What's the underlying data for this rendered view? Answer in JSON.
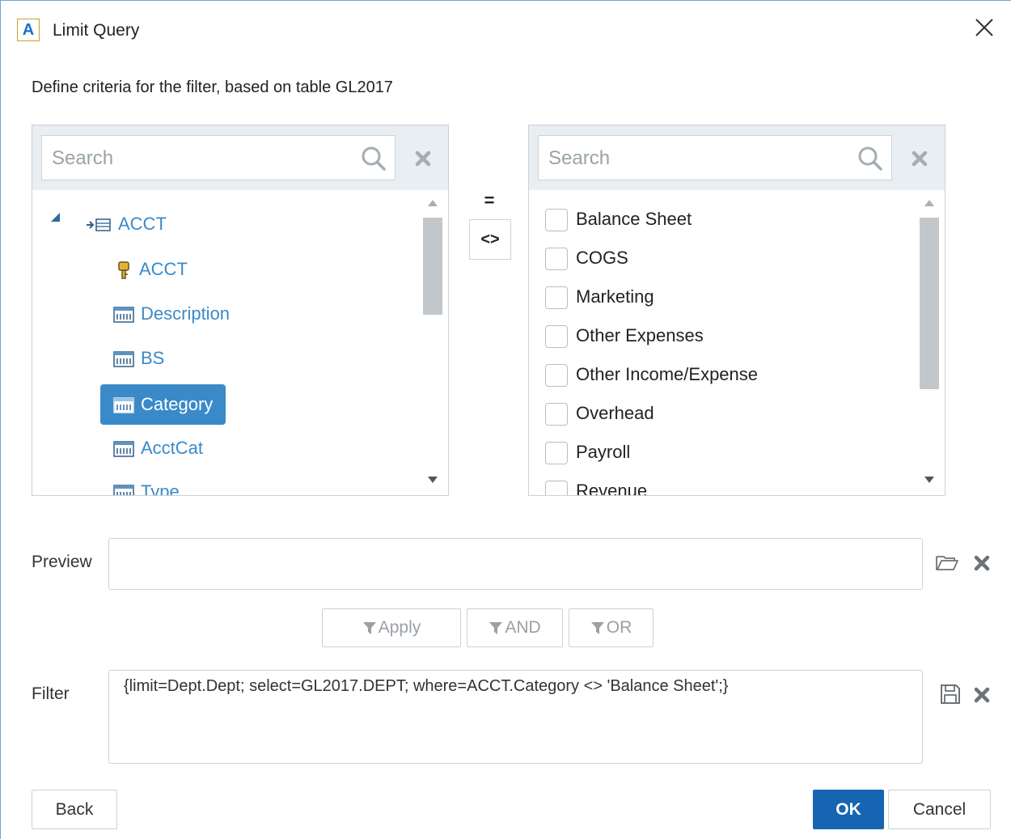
{
  "window": {
    "title": "Limit Query",
    "app_icon_letter": "A"
  },
  "subtitle": "Define criteria for the filter, based on table GL2017",
  "left_panel": {
    "search_placeholder": "Search",
    "tree": [
      {
        "label": "ACCT",
        "icon": "table-link-icon",
        "level": 0,
        "expanded": true
      },
      {
        "label": "ACCT",
        "icon": "key-icon",
        "level": 1
      },
      {
        "label": "Description",
        "icon": "field-icon",
        "level": 1
      },
      {
        "label": "BS",
        "icon": "field-icon",
        "level": 1
      },
      {
        "label": "Category",
        "icon": "field-icon",
        "level": 1,
        "selected": true
      },
      {
        "label": "AcctCat",
        "icon": "field-icon",
        "level": 1
      },
      {
        "label": "Type",
        "icon": "field-icon",
        "level": 1
      }
    ]
  },
  "operators": {
    "equals": "=",
    "not_equals": "<>"
  },
  "right_panel": {
    "search_placeholder": "Search",
    "values": [
      {
        "label": "Balance Sheet",
        "checked": false
      },
      {
        "label": "COGS",
        "checked": false
      },
      {
        "label": "Marketing",
        "checked": false
      },
      {
        "label": "Other Expenses",
        "checked": false
      },
      {
        "label": "Other Income/Expense",
        "checked": false
      },
      {
        "label": "Overhead",
        "checked": false
      },
      {
        "label": "Payroll",
        "checked": false
      },
      {
        "label": "Revenue",
        "checked": false
      }
    ]
  },
  "preview": {
    "label": "Preview",
    "value": ""
  },
  "logic_buttons": {
    "apply": "Apply",
    "and": "AND",
    "or": "OR"
  },
  "filter": {
    "label": "Filter",
    "value": "{limit=Dept.Dept; select=GL2017.DEPT; where=ACCT.Category <> 'Balance Sheet';}"
  },
  "footer": {
    "back": "Back",
    "ok": "OK",
    "cancel": "Cancel"
  },
  "colors": {
    "accent": "#3a8ac9",
    "primary_button": "#1565b3",
    "panel_header": "#e9eef2"
  }
}
